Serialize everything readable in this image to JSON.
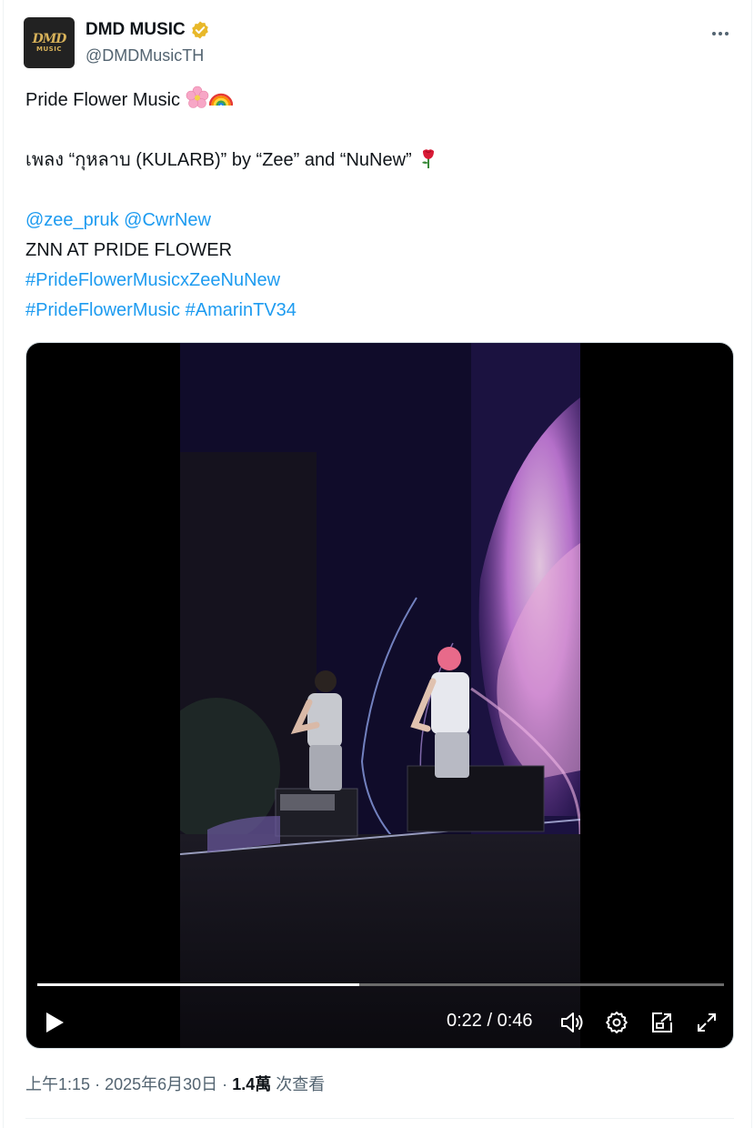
{
  "author": {
    "display_name": "DMD MUSIC",
    "handle": "@DMDMusicTH",
    "avatar_logo_top": "DMD",
    "avatar_logo_bottom": "MUSIC",
    "verified_icon": "verified-badge-gold",
    "verified_color": "#e8b829"
  },
  "tweet": {
    "line1": "Pride Flower Music",
    "line1_emojis": [
      "cherry-blossom-icon",
      "rainbow-icon"
    ],
    "line2": "เพลง “กุหลาบ (KULARB)” by “Zee” and “NuNew”",
    "line2_emoji": "rose-icon",
    "mention1": "@zee_pruk",
    "mention2": "@CwrNew",
    "line4": "ZNN AT PRIDE FLOWER",
    "hashtag1": "#PrideFlowerMusicxZeeNuNew",
    "hashtag2": "#PrideFlowerMusic",
    "hashtag3": "#AmarinTV34"
  },
  "video": {
    "current_time": "0:22",
    "separator": "/",
    "duration": "0:46",
    "progress_fraction": 0.469,
    "controls": [
      "play-icon",
      "volume-icon",
      "settings-gear-icon",
      "popout-icon",
      "fullscreen-icon"
    ]
  },
  "meta": {
    "time": "上午1:15",
    "dot1": "·",
    "date": "2025年6月30日",
    "dot2": "·",
    "views": "1.4萬",
    "views_label": "次查看"
  },
  "colors": {
    "link": "#1d9bf0",
    "secondary_text": "#536471",
    "primary_text": "#0f1419"
  }
}
